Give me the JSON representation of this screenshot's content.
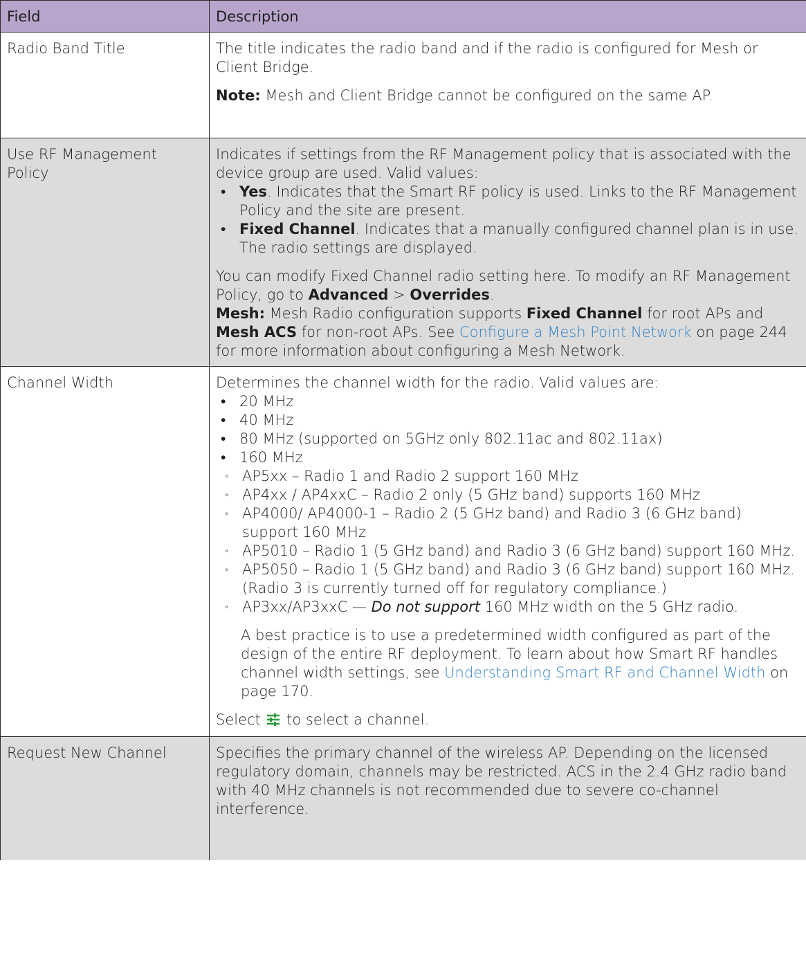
{
  "header": {
    "field": "Field",
    "description": "Description"
  },
  "rows": {
    "radio_band": {
      "field": "Radio Band Title",
      "desc_p1": "The title indicates the radio band and if the radio is configured for Mesh or Client Bridge.",
      "note_label": "Note:",
      "note_text": " Mesh and Client Bridge cannot be configured on the same AP."
    },
    "rf_policy": {
      "field": "Use RF Management Policy",
      "intro": "Indicates if settings from the RF Management policy that is associated with the device group are used. Valid values:",
      "yes_label": "Yes",
      "yes_text": ". Indicates that the Smart RF policy is used. Links to the RF Management Policy and the site are present.",
      "fixed_label": "Fixed Channel",
      "fixed_text": ". Indicates that a manually configured channel plan is in use. The radio settings are displayed.",
      "modify_text": "You can modify Fixed Channel radio setting here. To modify an RF Management Policy, go to ",
      "advanced": "Advanced",
      "gt": " > ",
      "overrides": "Overrides",
      "period": ".",
      "mesh_label": "Mesh:",
      "mesh_text1": " Mesh Radio configuration supports ",
      "mesh_fixed": "Fixed Channel",
      "mesh_text2": " for root APs and ",
      "mesh_acs": "Mesh ACS",
      "mesh_text3": " for non-root APs. See ",
      "mesh_link": "Configure a Mesh Point Network",
      "mesh_text4": " on page 244 for more information about configuring a Mesh Network."
    },
    "channel_width": {
      "field": "Channel Width",
      "intro": "Determines the channel width for the radio. Valid values are:",
      "values": [
        "20 MHz",
        "40 MHz",
        "80 MHz (supported on 5GHz only 802.11ac and 802.11ax)",
        "160 MHz"
      ],
      "sub": [
        "AP5xx – Radio 1 and Radio 2 support 160 MHz",
        "AP4xx / AP4xxC – Radio 2 only (5 GHz band) supports 160 MHz",
        "AP4000/ AP4000-1 – Radio 2 (5 GHz band) and Radio 3 (6 GHz band) support 160 MHz",
        "AP5010 – Radio 1 (5 GHz band) and Radio 3 (6 GHz band) support 160 MHz.",
        "AP5050 – Radio 1 (5 GHz band) and Radio 3 (6 GHz band) support 160 MHz. (Radio 3 is currently turned off for regulatory compliance.)"
      ],
      "ap3_prefix": "AP3xx/AP3xxC — ",
      "ap3_italic": "Do not support",
      "ap3_suffix": " 160 MHz width on the 5 GHz radio.",
      "best_text": "A best practice is to use a predetermined width configured as part of the design of the entire RF deployment. To learn about how Smart RF handles channel width settings, see ",
      "best_link": "Understanding Smart RF and Channel Width",
      "best_suffix": " on page 170.",
      "select_prefix": "Select ",
      "select_suffix": " to select a channel.",
      "icon": "sliders-icon",
      "icon_color": "#2e9a3e"
    },
    "request_channel": {
      "field": "Request New Channel",
      "desc": "Specifies the primary channel of the wireless AP. Depending on the licensed regulatory domain, channels may be restricted. ACS in the 2.4 GHz radio band with 40 MHz channels is not recommended due to severe co-channel interference."
    }
  },
  "colors": {
    "header_bg": "#b9a5cc",
    "alt_row_bg": "#dcdcdc",
    "link": "#2f7fc4"
  }
}
